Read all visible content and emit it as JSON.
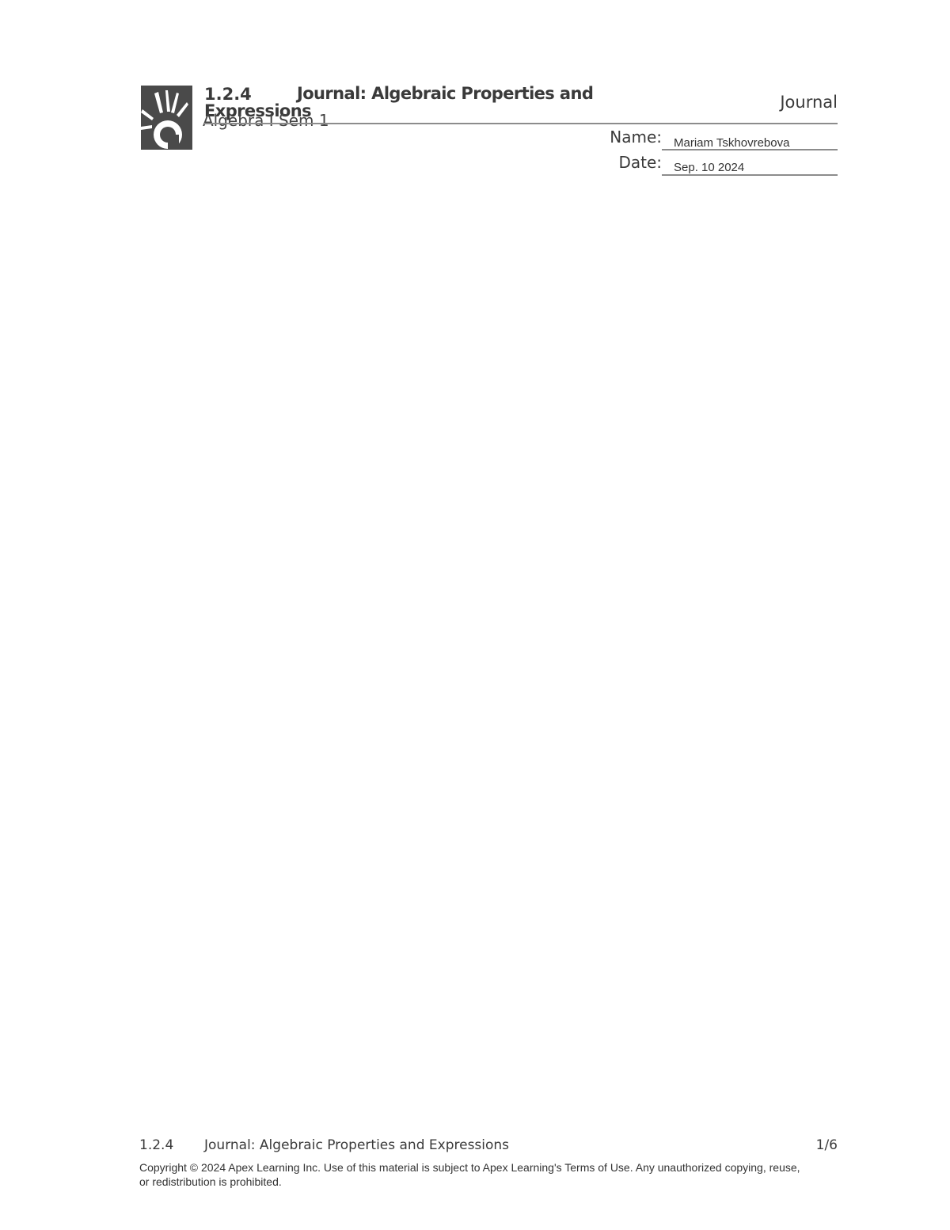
{
  "header": {
    "lesson_number": "1.2.4",
    "lesson_title": "Journal:  Algebraic Properties and Expressions",
    "course": "Algebra I Sem 1",
    "doc_type": "Journal"
  },
  "fields": {
    "name_label": "Name:",
    "name_value": "Mariam Tskhovrebova",
    "date_label": "Date:",
    "date_value": "Sep. 10 2024"
  },
  "footer": {
    "lesson_number": "1.2.4",
    "lesson_title": "Journal: Algebraic Properties and Expressions",
    "page": "1/6",
    "copyright": "Copyright © 2024 Apex Learning Inc. Use of this material is subject to Apex Learning's Terms of Use. Any unauthorized copying, reuse, or redistribution is prohibited."
  },
  "colors": {
    "logo": "#4a4a4a",
    "rule": "#8c8c8c",
    "text": "#3a3a3a"
  },
  "icons": {
    "logo": "apex-sunburst-logo-icon"
  }
}
